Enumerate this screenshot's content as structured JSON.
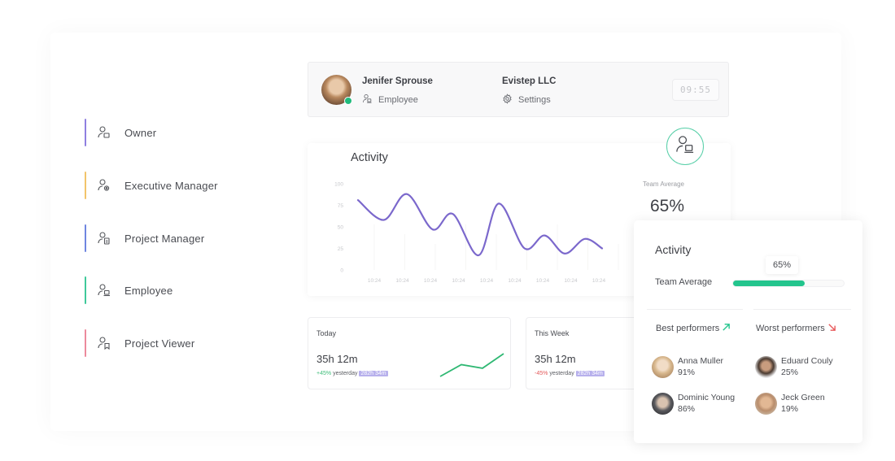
{
  "roles": [
    {
      "label": "Owner",
      "color": "#8f7fe0",
      "icon": "user-briefcase-icon"
    },
    {
      "label": "Executive Manager",
      "color": "#f2c46a",
      "icon": "user-gear-icon"
    },
    {
      "label": "Project Manager",
      "color": "#6f86e0",
      "icon": "user-document-icon"
    },
    {
      "label": "Employee",
      "color": "#3fc99a",
      "icon": "user-laptop-icon"
    },
    {
      "label": "Project Viewer",
      "color": "#ec8a9c",
      "icon": "user-bookmark-icon"
    }
  ],
  "header": {
    "user_name": "Jenifer Sprouse",
    "user_role": "Employee",
    "company": "Evistep LLC",
    "settings_label": "Settings",
    "timer": "09:55",
    "status": "online"
  },
  "activity_chart": {
    "title": "Activity",
    "team_average_label": "Team Average",
    "team_average_value": "65%"
  },
  "chart_data": {
    "type": "line",
    "title": "Activity",
    "xlabel": "",
    "ylabel": "",
    "ylim": [
      0,
      100
    ],
    "yticks": [
      "100",
      "75",
      "50",
      "25",
      "0"
    ],
    "x": [
      "10:24",
      "10:24",
      "10:24",
      "10:24",
      "10:24",
      "10:24",
      "10:24",
      "10:24",
      "10:24"
    ],
    "series": [
      {
        "name": "Activity",
        "color": "#7b68cc",
        "points": [
          [
            0,
            81
          ],
          [
            0.9,
            58
          ],
          [
            1.7,
            88
          ],
          [
            2.6,
            47
          ],
          [
            3.3,
            65
          ],
          [
            4.2,
            17
          ],
          [
            4.9,
            77
          ],
          [
            5.8,
            25
          ],
          [
            6.5,
            40
          ],
          [
            7.2,
            19
          ],
          [
            7.9,
            36
          ],
          [
            8.5,
            25
          ]
        ]
      }
    ],
    "grid": false
  },
  "stats": [
    {
      "title": "Today",
      "value": "35h 12m",
      "delta": "+45%",
      "delta_dir": "up",
      "yesterday_label": "yesterday",
      "yesterday_value": "282h 34m",
      "sparkline": [
        0,
        52,
        36,
        100
      ]
    },
    {
      "title": "This Week",
      "value": "35h 12m",
      "delta": "-45%",
      "delta_dir": "down",
      "yesterday_label": "yesterday",
      "yesterday_value": "282h 34m"
    }
  ],
  "performers": {
    "title": "Activity",
    "team_average_label": "Team Average",
    "team_average_value": "65%",
    "team_average_fraction": 0.65,
    "accent": "#23c58d",
    "best_label": "Best performers",
    "worst_label": "Worst performers",
    "best": [
      {
        "name": "Anna Muller",
        "pct": "91%"
      },
      {
        "name": "Dominic Young",
        "pct": "86%"
      }
    ],
    "worst": [
      {
        "name": "Eduard Couly",
        "pct": "25%"
      },
      {
        "name": "Jeck Green",
        "pct": "19%"
      }
    ]
  }
}
